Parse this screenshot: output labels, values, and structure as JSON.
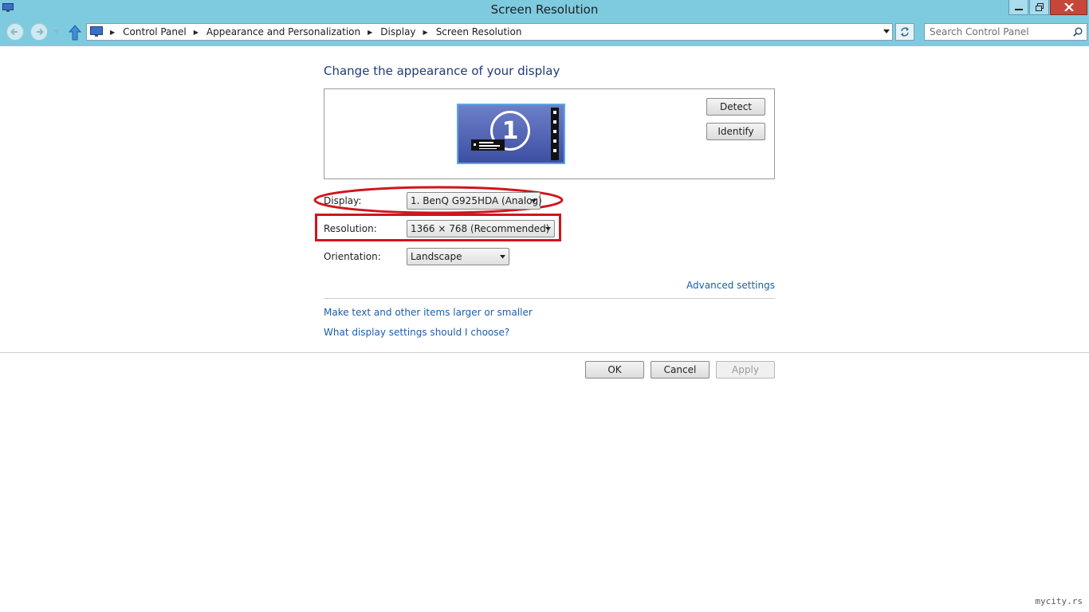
{
  "window": {
    "title": "Screen Resolution"
  },
  "navigation": {
    "breadcrumbs": [
      "Control Panel",
      "Appearance and Personalization",
      "Display",
      "Screen Resolution"
    ],
    "search_placeholder": "Search Control Panel"
  },
  "content": {
    "heading": "Change the appearance of your display",
    "monitor_number": "1",
    "detect_label": "Detect",
    "identify_label": "Identify",
    "display_label": "Display:",
    "display_value": "1. BenQ G925HDA (Analog)",
    "resolution_label": "Resolution:",
    "resolution_value": "1366 × 768 (Recommended)",
    "orientation_label": "Orientation:",
    "orientation_value": "Landscape",
    "advanced_link": "Advanced settings",
    "link_text_size": "Make text and other items larger or smaller",
    "link_help": "What display settings should I choose?"
  },
  "footer": {
    "ok_label": "OK",
    "cancel_label": "Cancel",
    "apply_label": "Apply"
  },
  "watermark": "mycity.rs",
  "colors": {
    "title_bar": "#7ecbe0",
    "link": "#1a5ea8",
    "annotation": "#d0151d",
    "monitor": "#4a5db0"
  }
}
